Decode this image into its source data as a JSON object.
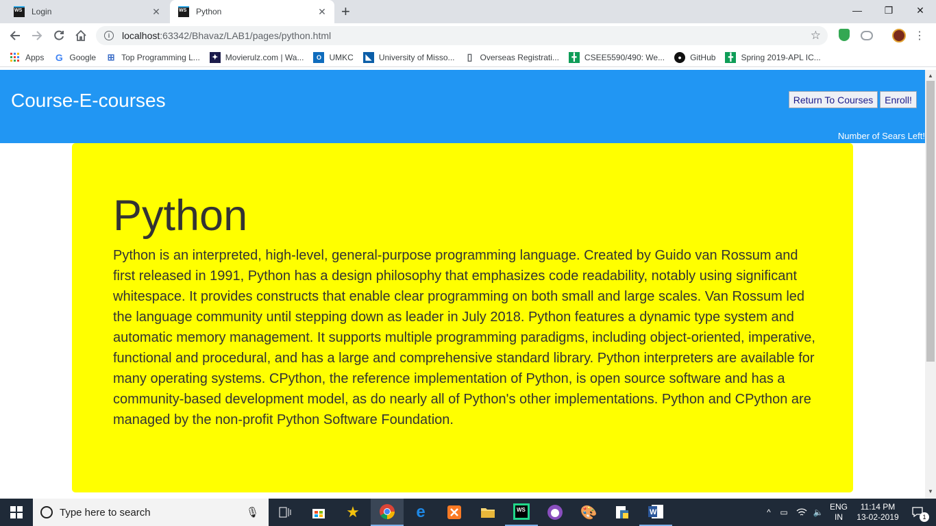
{
  "browser": {
    "tabs": [
      {
        "label": "Login",
        "favicon": "WS"
      },
      {
        "label": "Python",
        "favicon": "WS"
      }
    ],
    "new_tab_symbol": "+",
    "close_symbol": "✕",
    "window": {
      "minimize": "—",
      "restore": "❐",
      "close": "✕"
    },
    "address": {
      "host": "localhost",
      "path": ":63342/Bhavaz/LAB1/pages/python.html"
    },
    "bookmarks": [
      {
        "label": "Apps",
        "icon": "apps-grid-icon"
      },
      {
        "label": "Google",
        "icon": "google-icon"
      },
      {
        "label": "Top Programming L...",
        "icon": "page-icon"
      },
      {
        "label": "Movierulz.com | Wa...",
        "icon": "movierulz-icon"
      },
      {
        "label": "UMKC",
        "icon": "outlook-icon"
      },
      {
        "label": "University of Misso...",
        "icon": "umkc-icon"
      },
      {
        "label": "Overseas Registrati...",
        "icon": "document-icon"
      },
      {
        "label": "CSEE5590/490: We...",
        "icon": "sheets-icon"
      },
      {
        "label": "GitHub",
        "icon": "github-icon"
      },
      {
        "label": "Spring 2019-APL IC...",
        "icon": "sheets-icon"
      }
    ]
  },
  "page": {
    "brand": "Course-E-courses",
    "return_button": "Return To Courses",
    "enroll_button": "Enroll!",
    "seats_text": "Number of Sears Left!",
    "heading": "Python",
    "body": "Python is an interpreted, high-level, general-purpose programming language. Created by Guido van Rossum and first released in 1991, Python has a design philosophy that emphasizes code readability, notably using significant whitespace. It provides constructs that enable clear programming on both small and large scales. Van Rossum led the language community until stepping down as leader in July 2018. Python features a dynamic type system and automatic memory management. It supports multiple programming paradigms, including object-oriented, imperative, functional and procedural, and has a large and comprehensive standard library. Python interpreters are available for many operating systems. CPython, the reference implementation of Python, is open source software and has a community-based development model, as do nearly all of Python's other implementations. Python and CPython are managed by the non-profit Python Software Foundation."
  },
  "taskbar": {
    "search_placeholder": "Type here to search",
    "language": "ENG",
    "region": "IN",
    "time": "11:14 PM",
    "date": "13-02-2019",
    "notification_count": "1"
  },
  "colors": {
    "header": "#2196f3",
    "card": "#ffff00",
    "taskbar": "#1f2a38"
  }
}
